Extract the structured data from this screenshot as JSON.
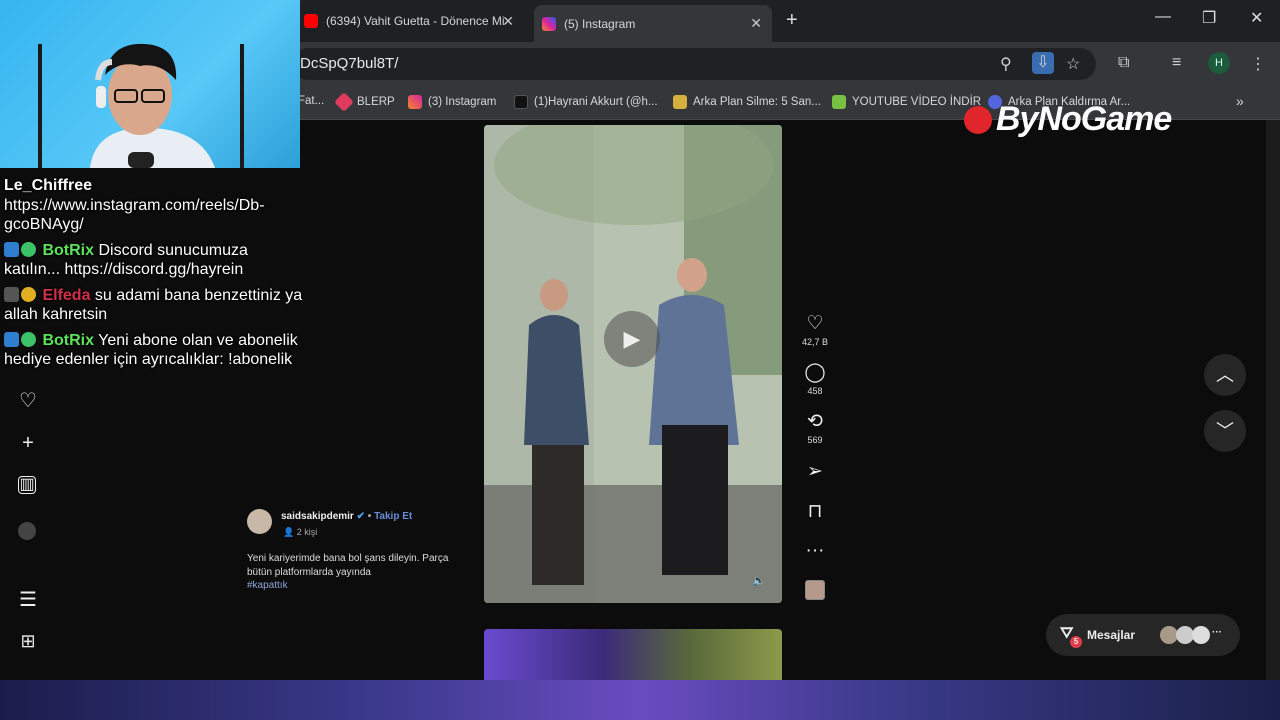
{
  "tabs": [
    {
      "title": "(6394) Vahit Guetta - Dönence Mi",
      "icon": "youtube-icon",
      "color": "#ff0000"
    },
    {
      "title": "(5) Instagram",
      "icon": "instagram-icon",
      "color": "#d6249f"
    }
  ],
  "url": "DcSpQ7bul8T/",
  "profile_initial": "H",
  "bookmarks": [
    {
      "label": "Fat...",
      "icon": "red-icon",
      "color": "#d22"
    },
    {
      "label": "BLERP",
      "icon": "blerp-icon",
      "color": "#e03a5c"
    },
    {
      "label": "(3) Instagram",
      "icon": "instagram-icon",
      "color": "#d6249f"
    },
    {
      "label": "(1)Hayrani Akkurt (@h...",
      "icon": "tiktok-icon",
      "color": "#111"
    },
    {
      "label": "Arka Plan Silme: 5 San...",
      "icon": "layers-icon",
      "color": "#d8b040"
    },
    {
      "label": "YOUTUBE VİDEO İNDİR",
      "icon": "download-icon",
      "color": "#7ac043"
    },
    {
      "label": "Arka Plan Kaldırma Ar...",
      "icon": "p-icon",
      "color": "#5566dd"
    }
  ],
  "watermark": "ByNoGame",
  "chat": [
    {
      "user": "Le_Chiffree",
      "text": "https://www.instagram.com/reels/Db-gcoBNAyg/",
      "type": "lc"
    },
    {
      "user": "BotRix",
      "text": " Discord sunucumuza katılın... https://discord.gg/hayrein",
      "type": "bot"
    },
    {
      "user": "Elfeda",
      "text": " su adami bana benzettiniz ya allah kahretsin",
      "type": "elfeda"
    },
    {
      "user": "BotRix",
      "text": " Yeni abone olan ve abonelik hediye edenler için ayrıcalıklar: !abonelik",
      "type": "bot"
    }
  ],
  "post": {
    "author": "saidsakipdemir",
    "follow": "Takip Et",
    "followers": "2 kişi",
    "caption": "Yeni kariyerimde bana bol şans dileyin. Parça bütün platformlarda yayında",
    "hashtag": "#kapattık"
  },
  "actions": {
    "likes": "42,7 B",
    "comments": "458",
    "reposts": "569"
  },
  "messages": {
    "label": "Mesajlar",
    "badge": "5"
  }
}
